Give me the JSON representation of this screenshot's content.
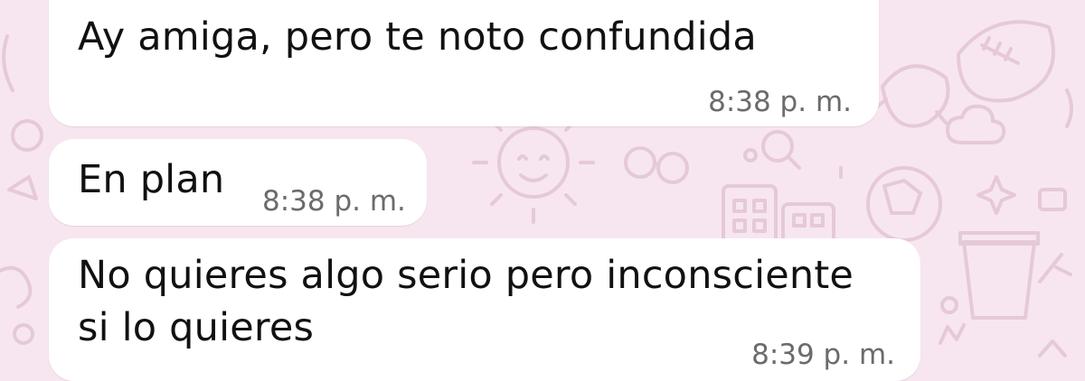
{
  "chat": {
    "messages": [
      {
        "text": "Ay amiga, pero te noto confundida",
        "time": "8:38 p. m."
      },
      {
        "text": "En plan",
        "time": "8:38 p. m."
      },
      {
        "text_lines": [
          "No quieres algo serio pero inconsciente",
          "si lo quieres"
        ],
        "time": "8:39 p. m."
      }
    ],
    "colors": {
      "wallpaper": "#f7e6ef",
      "doodle": "#e6c9d8",
      "bubble": "#ffffff",
      "text": "#111111",
      "timestamp": "#6b6b6b"
    }
  }
}
